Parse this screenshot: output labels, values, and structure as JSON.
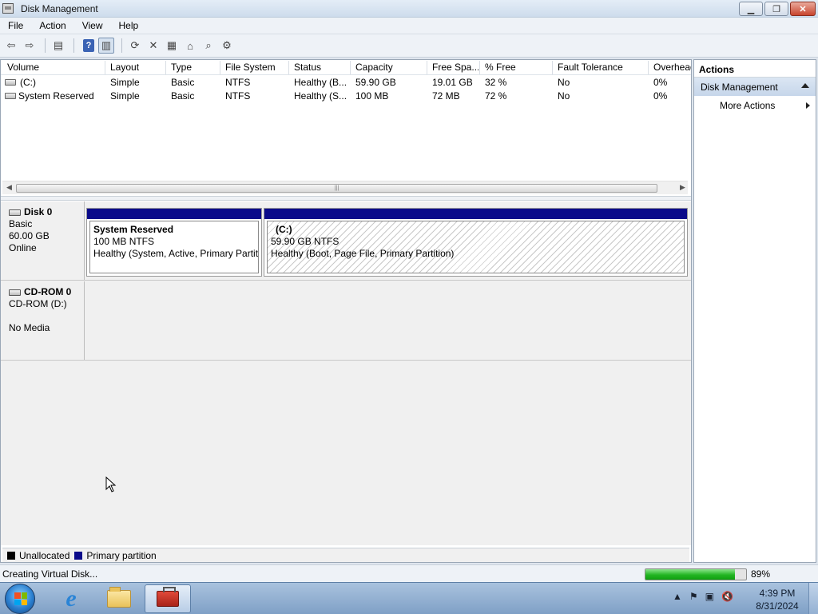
{
  "window": {
    "title": "Disk Management"
  },
  "menu": [
    "File",
    "Action",
    "View",
    "Help"
  ],
  "volume_list": {
    "columns": [
      "Volume",
      "Layout",
      "Type",
      "File System",
      "Status",
      "Capacity",
      "Free Spa...",
      "% Free",
      "Fault Tolerance",
      "Overhead"
    ],
    "rows": [
      [
        "(C:)",
        "Simple",
        "Basic",
        "NTFS",
        "Healthy (B...",
        "59.90 GB",
        "19.01 GB",
        "32 %",
        "No",
        "0%"
      ],
      [
        "System Reserved",
        "Simple",
        "Basic",
        "NTFS",
        "Healthy (S...",
        "100 MB",
        "72 MB",
        "72 %",
        "No",
        "0%"
      ]
    ]
  },
  "disks": [
    {
      "name": "Disk 0",
      "lines": [
        "Basic",
        "60.00 GB",
        "Online"
      ],
      "partitions": [
        {
          "title": "System Reserved",
          "size": "100 MB NTFS",
          "status": "Healthy (System, Active, Primary Partiti"
        },
        {
          "title": "(C:)",
          "size": "59.90 GB NTFS",
          "status": "Healthy (Boot, Page File, Primary Partition)"
        }
      ]
    },
    {
      "name": "CD-ROM 0",
      "lines": [
        "CD-ROM (D:)",
        "",
        "No Media"
      ]
    }
  ],
  "legend": [
    {
      "label": "Unallocated",
      "color": "#000000"
    },
    {
      "label": "Primary partition",
      "color": "#0a0a8a"
    }
  ],
  "actions": {
    "header": "Actions",
    "section": "Disk Management",
    "items": [
      "More Actions"
    ]
  },
  "statusbar": {
    "text": "Creating Virtual Disk...",
    "progress_percent": 89,
    "progress_label": "89%"
  },
  "taskbar": {
    "time": "4:39 PM",
    "date": "8/31/2024"
  }
}
